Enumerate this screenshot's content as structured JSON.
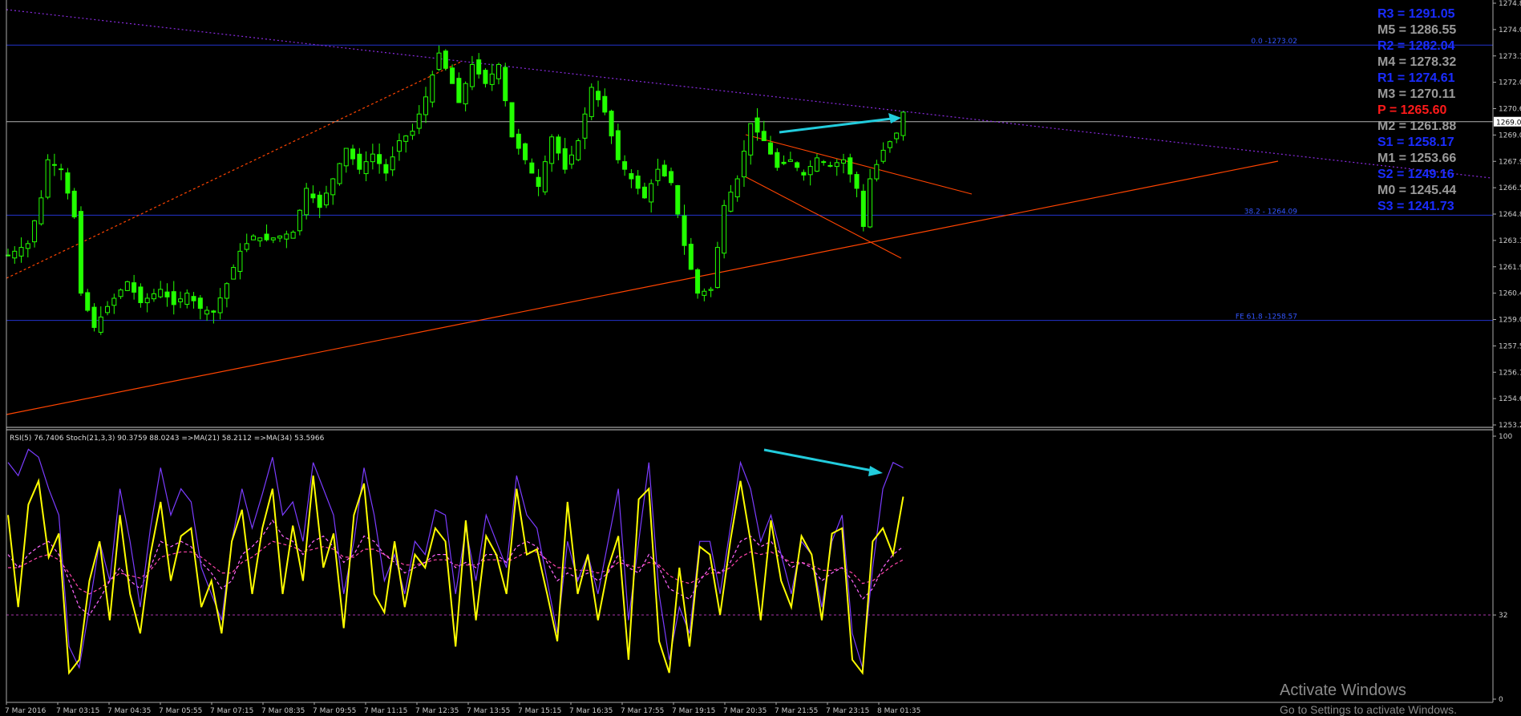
{
  "chart_data": [
    {
      "type": "candlestick",
      "panel": "price",
      "x_tick_labels": [
        "7 Mar 2016",
        "7 Mar 03:15",
        "7 Mar 04:35",
        "7 Mar 05:55",
        "7 Mar 07:15",
        "7 Mar 08:35",
        "7 Mar 09:55",
        "7 Mar 11:15",
        "7 Mar 12:35",
        "7 Mar 13:55",
        "7 Mar 15:15",
        "7 Mar 16:35",
        "7 Mar 17:55",
        "7 Mar 19:15",
        "7 Mar 20:35",
        "7 Mar 21:55",
        "7 Mar 23:15",
        "8 Mar 01:35"
      ],
      "y_tick_labels": [
        "1274.8",
        "1274.0",
        "1273.3",
        "1272.0",
        "1270.6",
        "1269.0",
        "1267.9",
        "1266.5",
        "1264.8",
        "1263.3",
        "1261.9",
        "1260.4",
        "1259.0",
        "1257.5",
        "1256.1",
        "1254.6",
        "1253.2"
      ],
      "current_price_label": "1269.0",
      "ylim": [
        1253.0,
        1275.3
      ],
      "close_path": [
        [
          0,
          1262.0
        ],
        [
          3,
          1262.6
        ],
        [
          5,
          1265.0
        ],
        [
          6,
          1267.0
        ],
        [
          8,
          1266.5
        ],
        [
          10,
          1264.0
        ],
        [
          11,
          1260.0
        ],
        [
          13,
          1258.2
        ],
        [
          15,
          1259.3
        ],
        [
          18,
          1260.6
        ],
        [
          20,
          1259.5
        ],
        [
          23,
          1260.2
        ],
        [
          25,
          1259.4
        ],
        [
          27,
          1260.0
        ],
        [
          29,
          1259.2
        ],
        [
          31,
          1259.0
        ],
        [
          33,
          1260.5
        ],
        [
          35,
          1262.2
        ],
        [
          37,
          1263.0
        ],
        [
          39,
          1262.8
        ],
        [
          41,
          1263.0
        ],
        [
          43,
          1263.2
        ],
        [
          45,
          1265.5
        ],
        [
          47,
          1264.5
        ],
        [
          49,
          1266.0
        ],
        [
          51,
          1267.6
        ],
        [
          53,
          1266.5
        ],
        [
          55,
          1267.3
        ],
        [
          57,
          1266.3
        ],
        [
          59,
          1268.0
        ],
        [
          61,
          1268.5
        ],
        [
          63,
          1270.3
        ],
        [
          65,
          1272.6
        ],
        [
          67,
          1271.0
        ],
        [
          68,
          1270.0
        ],
        [
          70,
          1272.0
        ],
        [
          72,
          1271.0
        ],
        [
          74,
          1272.0
        ],
        [
          76,
          1268.2
        ],
        [
          78,
          1267.0
        ],
        [
          80,
          1265.6
        ],
        [
          82,
          1268.2
        ],
        [
          84,
          1266.5
        ],
        [
          86,
          1268.0
        ],
        [
          88,
          1270.8
        ],
        [
          90,
          1269.5
        ],
        [
          92,
          1267.0
        ],
        [
          94,
          1266.0
        ],
        [
          96,
          1265.0
        ],
        [
          98,
          1266.5
        ],
        [
          100,
          1265.8
        ],
        [
          102,
          1262.5
        ],
        [
          104,
          1260.0
        ],
        [
          106,
          1260.2
        ],
        [
          108,
          1264.6
        ],
        [
          110,
          1266.0
        ],
        [
          112,
          1268.9
        ],
        [
          114,
          1268.0
        ],
        [
          116,
          1266.6
        ],
        [
          118,
          1267.0
        ],
        [
          120,
          1266.2
        ],
        [
          122,
          1267.1
        ],
        [
          124,
          1266.7
        ],
        [
          126,
          1267.0
        ],
        [
          128,
          1265.5
        ],
        [
          129,
          1263.5
        ],
        [
          130,
          1266.0
        ],
        [
          132,
          1267.5
        ],
        [
          134,
          1268.4
        ],
        [
          135,
          1269.5
        ]
      ],
      "horizontal_lines": [
        {
          "label": "0.0 -1273.02",
          "value": 1273.02
        },
        {
          "label": "38.2 - 1264.09",
          "value": 1264.09
        },
        {
          "label": "FE 61.8 -1258.57",
          "value": 1258.57
        },
        {
          "label": "",
          "value": 1269.0
        }
      ],
      "pivot_levels": [
        {
          "label": "R3 = 1291.05",
          "color": "#1a2cff"
        },
        {
          "label": "M5 = 1286.55",
          "color": "#9a9a9a"
        },
        {
          "label": "R2 = 1282.04",
          "color": "#1a2cff"
        },
        {
          "label": "M4 = 1278.32",
          "color": "#9a9a9a"
        },
        {
          "label": "R1 = 1274.61",
          "color": "#1a2cff"
        },
        {
          "label": "M3 = 1270.11",
          "color": "#9a9a9a"
        },
        {
          "label": "P  = 1265.60",
          "color": "#ff1a1a"
        },
        {
          "label": "M2 = 1261.88",
          "color": "#9a9a9a"
        },
        {
          "label": "S1 = 1258.17",
          "color": "#1a2cff"
        },
        {
          "label": "M1 = 1253.66",
          "color": "#9a9a9a"
        },
        {
          "label": "S2 = 1249.16",
          "color": "#1a2cff"
        },
        {
          "label": "M0 = 1245.44",
          "color": "#9a9a9a"
        },
        {
          "label": "S3 = 1241.73",
          "color": "#1a2cff"
        }
      ],
      "colors": {
        "candles": "#22ff00",
        "fib_lines": "#2233cc",
        "trendline": "#ff4400",
        "resistance": "#8a2be2",
        "arrow": "#22ccdd"
      }
    },
    {
      "type": "line",
      "panel": "oscillator",
      "header": "RSI(5) 76.7406  Stoch(21,3,3) 90.3759 88.0243  =>MA(21) 58.2112  =>MA(34) 53.5966",
      "y_tick_labels": [
        "100",
        "32",
        "0"
      ],
      "ylim": [
        0,
        100
      ],
      "level_line": 32,
      "series": [
        {
          "name": "RSI(5)",
          "color": "#ffff00",
          "values": [
            70,
            35,
            74,
            83,
            54,
            63,
            10,
            15,
            45,
            60,
            30,
            70,
            40,
            25,
            55,
            75,
            45,
            62,
            65,
            35,
            45,
            25,
            60,
            72,
            40,
            65,
            80,
            40,
            66,
            45,
            85,
            50,
            63,
            27,
            70,
            82,
            40,
            33,
            60,
            35,
            55,
            50,
            65,
            60,
            20,
            68,
            30,
            62,
            55,
            40,
            80,
            55,
            57,
            40,
            22,
            75,
            40,
            55,
            30,
            50,
            62,
            15,
            76,
            80,
            22,
            10,
            50,
            20,
            58,
            55,
            32,
            60,
            83,
            60,
            30,
            68,
            45,
            35,
            62,
            55,
            30,
            63,
            65,
            15,
            10,
            60,
            65,
            55,
            77
          ]
        },
        {
          "name": "Stoch(21,3,3)",
          "color": "#7b3cff",
          "values": [
            90,
            85,
            95,
            92,
            80,
            70,
            20,
            12,
            35,
            60,
            45,
            80,
            60,
            35,
            65,
            88,
            70,
            80,
            75,
            50,
            40,
            30,
            60,
            80,
            65,
            78,
            92,
            70,
            75,
            60,
            90,
            80,
            70,
            40,
            60,
            88,
            70,
            45,
            55,
            40,
            60,
            55,
            72,
            70,
            40,
            65,
            45,
            70,
            60,
            50,
            85,
            70,
            65,
            45,
            25,
            60,
            45,
            55,
            40,
            60,
            80,
            30,
            60,
            90,
            40,
            15,
            35,
            25,
            60,
            60,
            40,
            65,
            90,
            80,
            60,
            70,
            55,
            40,
            60,
            55,
            35,
            60,
            70,
            25,
            12,
            50,
            80,
            90,
            88
          ]
        },
        {
          "name": "MA(21)",
          "color": "#ff66ff",
          "dashed": true,
          "values": [
            55,
            50,
            55,
            58,
            60,
            55,
            45,
            35,
            32,
            38,
            45,
            50,
            45,
            42,
            50,
            60,
            58,
            60,
            58,
            52,
            48,
            42,
            45,
            55,
            58,
            62,
            68,
            62,
            60,
            55,
            60,
            62,
            58,
            52,
            55,
            62,
            60,
            55,
            52,
            48,
            50,
            52,
            55,
            55,
            50,
            52,
            50,
            55,
            55,
            52,
            58,
            60,
            58,
            52,
            45,
            48,
            46,
            48,
            45,
            48,
            55,
            50,
            48,
            55,
            50,
            42,
            40,
            38,
            45,
            50,
            48,
            52,
            60,
            62,
            58,
            60,
            55,
            50,
            52,
            50,
            45,
            48,
            50,
            45,
            38,
            42,
            50,
            55,
            58
          ]
        },
        {
          "name": "MA(34)",
          "color": "#ff44aa",
          "dashed": true,
          "values": [
            50,
            50,
            52,
            54,
            55,
            53,
            48,
            42,
            40,
            42,
            45,
            48,
            47,
            46,
            49,
            54,
            55,
            56,
            56,
            54,
            51,
            48,
            48,
            52,
            54,
            57,
            60,
            59,
            58,
            56,
            57,
            58,
            57,
            54,
            54,
            57,
            57,
            55,
            53,
            51,
            51,
            52,
            53,
            53,
            51,
            51,
            51,
            53,
            53,
            52,
            54,
            56,
            56,
            53,
            50,
            50,
            49,
            49,
            48,
            49,
            52,
            51,
            50,
            52,
            51,
            47,
            45,
            44,
            46,
            48,
            48,
            50,
            54,
            56,
            55,
            56,
            54,
            52,
            52,
            51,
            49,
            49,
            50,
            48,
            44,
            45,
            48,
            51,
            53
          ]
        }
      ]
    }
  ],
  "watermark": {
    "title": "Activate Windows",
    "subtitle": "Go to Settings to activate Windows."
  }
}
